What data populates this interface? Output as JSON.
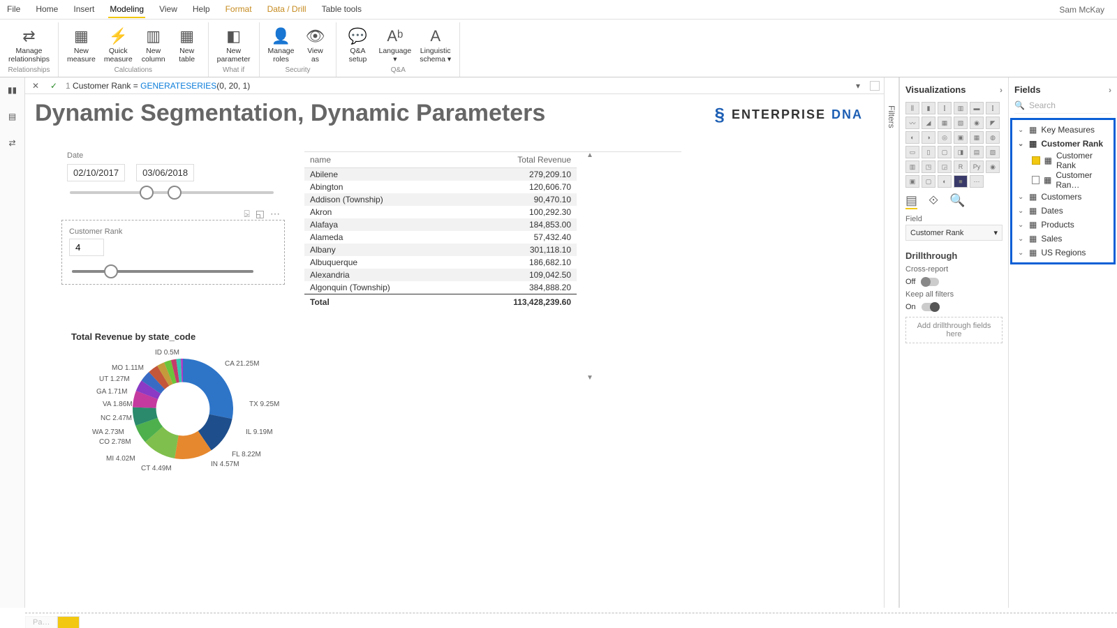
{
  "user": "Sam McKay",
  "menu_tabs": [
    "File",
    "Home",
    "Insert",
    "Modeling",
    "View",
    "Help",
    "Format",
    "Data / Drill",
    "Table tools"
  ],
  "active_tab": "Modeling",
  "ribbon": {
    "groups": [
      {
        "label": "Relationships",
        "buttons": [
          {
            "name": "manage-relationships",
            "label": "Manage\nrelationships",
            "icon": "⇄"
          }
        ]
      },
      {
        "label": "Calculations",
        "buttons": [
          {
            "name": "new-measure",
            "label": "New\nmeasure",
            "icon": "▦"
          },
          {
            "name": "quick-measure",
            "label": "Quick\nmeasure",
            "icon": "⚡"
          },
          {
            "name": "new-column",
            "label": "New\ncolumn",
            "icon": "▥"
          },
          {
            "name": "new-table",
            "label": "New\ntable",
            "icon": "▦"
          }
        ]
      },
      {
        "label": "What if",
        "buttons": [
          {
            "name": "new-parameter",
            "label": "New\nparameter",
            "icon": "◧"
          }
        ]
      },
      {
        "label": "Security",
        "buttons": [
          {
            "name": "manage-roles",
            "label": "Manage\nroles",
            "icon": "👤"
          },
          {
            "name": "view-as",
            "label": "View\nas",
            "icon": "👁"
          }
        ]
      },
      {
        "label": "Q&A",
        "buttons": [
          {
            "name": "qa-setup",
            "label": "Q&A\nsetup",
            "icon": "💬"
          },
          {
            "name": "language",
            "label": "Language\n▾",
            "icon": "Aᵇ"
          },
          {
            "name": "linguistic-schema",
            "label": "Linguistic\nschema ▾",
            "icon": "A"
          }
        ]
      }
    ]
  },
  "formula": {
    "line": "1",
    "name": "Customer Rank",
    "op": "=",
    "func": "GENERATESERIES",
    "args": "(0, 20, 1)"
  },
  "report": {
    "title": "Dynamic Segmentation, Dynamic Parameters",
    "brand": "ENTERPRISE",
    "brand2": "DNA"
  },
  "date_slicer": {
    "title": "Date",
    "from": "02/10/2017",
    "to": "03/06/2018"
  },
  "rank_slicer": {
    "title": "Customer Rank",
    "value": "4"
  },
  "table": {
    "columns": [
      "name",
      "Total Revenue"
    ],
    "rows": [
      [
        "Abilene",
        "279,209.10"
      ],
      [
        "Abington",
        "120,606.70"
      ],
      [
        "Addison (Township)",
        "90,470.10"
      ],
      [
        "Akron",
        "100,292.30"
      ],
      [
        "Alafaya",
        "184,853.00"
      ],
      [
        "Alameda",
        "57,432.40"
      ],
      [
        "Albany",
        "301,118.10"
      ],
      [
        "Albuquerque",
        "186,682.10"
      ],
      [
        "Alexandria",
        "109,042.50"
      ],
      [
        "Algonquin (Township)",
        "384,888.20"
      ]
    ],
    "total_label": "Total",
    "total_value": "113,428,239.60"
  },
  "chart_data": {
    "type": "pie",
    "title": "Total Revenue by state_code",
    "slices": [
      {
        "label": "CA 21.25M",
        "value": 21.25,
        "color": "#2e75c8"
      },
      {
        "label": "TX 9.25M",
        "value": 9.25,
        "color": "#1e4e8c"
      },
      {
        "label": "IL 9.19M",
        "value": 9.19,
        "color": "#e6882e"
      },
      {
        "label": "FL 8.22M",
        "value": 8.22,
        "color": "#7fbf4d"
      },
      {
        "label": "IN 4.57M",
        "value": 4.57,
        "color": "#4db04d"
      },
      {
        "label": "CT 4.49M",
        "value": 4.49,
        "color": "#2a8a6b"
      },
      {
        "label": "MI 4.02M",
        "value": 4.02,
        "color": "#c43a9e"
      },
      {
        "label": "CO 2.78M",
        "value": 2.78,
        "color": "#8a3ac4"
      },
      {
        "label": "WA 2.73M",
        "value": 2.73,
        "color": "#3a6bc4"
      },
      {
        "label": "NC 2.47M",
        "value": 2.47,
        "color": "#c4563a"
      },
      {
        "label": "VA 1.86M",
        "value": 1.86,
        "color": "#c49a3a"
      },
      {
        "label": "GA 1.71M",
        "value": 1.71,
        "color": "#6bc43a"
      },
      {
        "label": "UT 1.27M",
        "value": 1.27,
        "color": "#c43a6b"
      },
      {
        "label": "MO 1.11M",
        "value": 1.11,
        "color": "#3ac4b0"
      },
      {
        "label": "ID 0.5M",
        "value": 0.5,
        "color": "#b03ac4"
      }
    ]
  },
  "viz_panel": {
    "title": "Visualizations",
    "field_label": "Field",
    "field_value": "Customer Rank",
    "drill_title": "Drillthrough",
    "cross_report_label": "Cross-report",
    "cross_report_state": "Off",
    "keep_filters_label": "Keep all filters",
    "keep_filters_state": "On",
    "drop_hint": "Add drillthrough fields here"
  },
  "fields_panel": {
    "title": "Fields",
    "search_placeholder": "Search",
    "tables": [
      {
        "name": "Key Measures",
        "expandable": true
      },
      {
        "name": "Customer Rank",
        "expandable": true,
        "bold": true,
        "children": [
          {
            "name": "Customer Rank",
            "checked": true
          },
          {
            "name": "Customer Ran…",
            "checked": false
          }
        ]
      },
      {
        "name": "Customers",
        "expandable": true
      },
      {
        "name": "Dates",
        "expandable": true
      },
      {
        "name": "Products",
        "expandable": true
      },
      {
        "name": "Sales",
        "expandable": true
      },
      {
        "name": "US Regions",
        "expandable": true
      }
    ]
  },
  "filters_label": "Filters"
}
